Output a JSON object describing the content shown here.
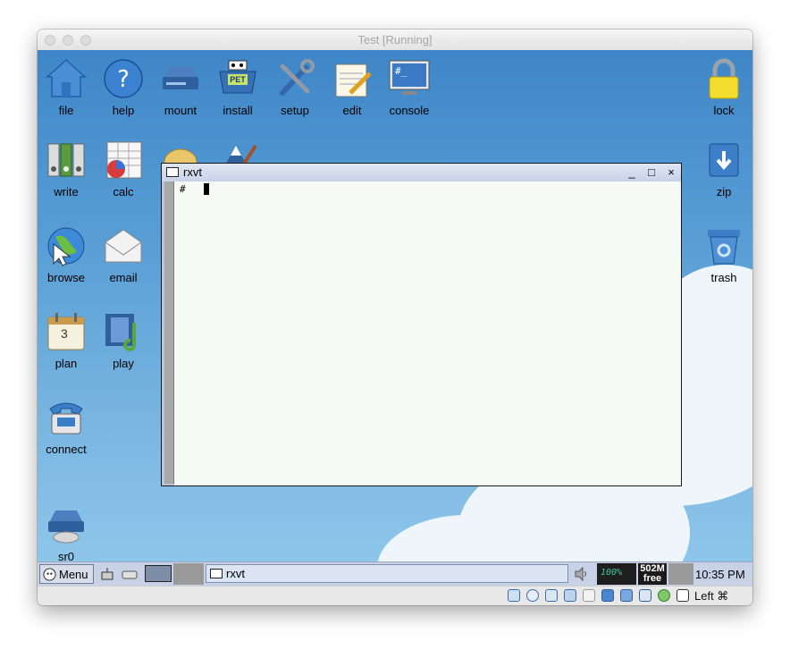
{
  "window": {
    "title": "Test [Running]"
  },
  "desktop": {
    "icons": [
      {
        "label": "file",
        "icon": "house-icon"
      },
      {
        "label": "help",
        "icon": "question-icon"
      },
      {
        "label": "mount",
        "icon": "drive-icon"
      },
      {
        "label": "install",
        "icon": "pet-box-icon",
        "badge": "PET"
      },
      {
        "label": "setup",
        "icon": "tools-icon"
      },
      {
        "label": "edit",
        "icon": "notepad-icon"
      },
      {
        "label": "console",
        "icon": "monitor-icon",
        "screen_text": "#_"
      },
      {
        "label": "lock",
        "icon": "padlock-icon"
      },
      {
        "label": "write",
        "icon": "binders-icon"
      },
      {
        "label": "calc",
        "icon": "spreadsheet-icon"
      },
      {
        "label": "zip",
        "icon": "archive-icon"
      },
      {
        "label": "browse",
        "icon": "globe-icon"
      },
      {
        "label": "email",
        "icon": "envelope-icon"
      },
      {
        "label": "trash",
        "icon": "recycle-bin-icon"
      },
      {
        "label": "plan",
        "icon": "calendar-icon",
        "day": "3"
      },
      {
        "label": "play",
        "icon": "media-icon"
      },
      {
        "label": "connect",
        "icon": "telephone-icon"
      },
      {
        "label": "sr0",
        "icon": "cdrom-icon"
      }
    ]
  },
  "terminal": {
    "title": "rxvt",
    "prompt": "#",
    "buttons": {
      "minimize": "_",
      "maximize": "□",
      "close": "×"
    }
  },
  "taskbar": {
    "menu_label": "Menu",
    "task_label": "rxvt",
    "battery": "100%",
    "memory_top": "502M",
    "memory_bottom": "free",
    "clock": "10:35 PM"
  },
  "statusbar": {
    "host_key": "Left ⌘"
  },
  "colors": {
    "desktop_top": "#3f86c8",
    "desktop_bottom": "#8ec6ea",
    "taskbar": "#c8d2e6",
    "terminal_bg": "#f5faf5"
  }
}
